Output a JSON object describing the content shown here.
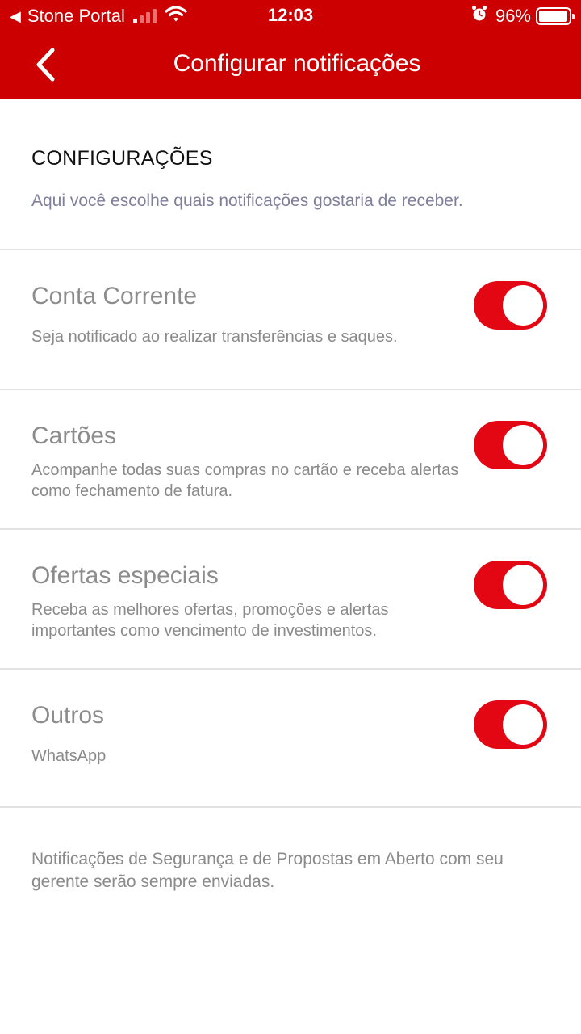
{
  "status_bar": {
    "back_app": "Stone Portal",
    "time": "12:03",
    "battery": "96%",
    "battery_level": 0.96,
    "signal_bars": 1
  },
  "header": {
    "title": "Configurar notificações",
    "background_color": "#cc0000"
  },
  "intro": {
    "title": "CONFIGURAÇÕES",
    "description": "Aqui você escolhe quais notificações gostaria de receber."
  },
  "settings": [
    {
      "title": "Conta Corrente",
      "description": "Seja notificado ao realizar transferências e saques.",
      "enabled": true
    },
    {
      "title": "Cartões",
      "description": "Acompanhe todas suas compras no cartão e receba alertas como fechamento de fatura.",
      "enabled": true
    },
    {
      "title": "Ofertas especiais",
      "description": "Receba as melhores ofertas, promoções e alertas importantes como vencimento de investimentos.",
      "enabled": true
    },
    {
      "title": "Outros",
      "description": "WhatsApp",
      "enabled": true
    }
  ],
  "footer": {
    "note": "Notificações de Segurança e de Propostas em Aberto com seu gerente serão sempre enviadas."
  },
  "colors": {
    "toggle_on": "#e30613"
  }
}
